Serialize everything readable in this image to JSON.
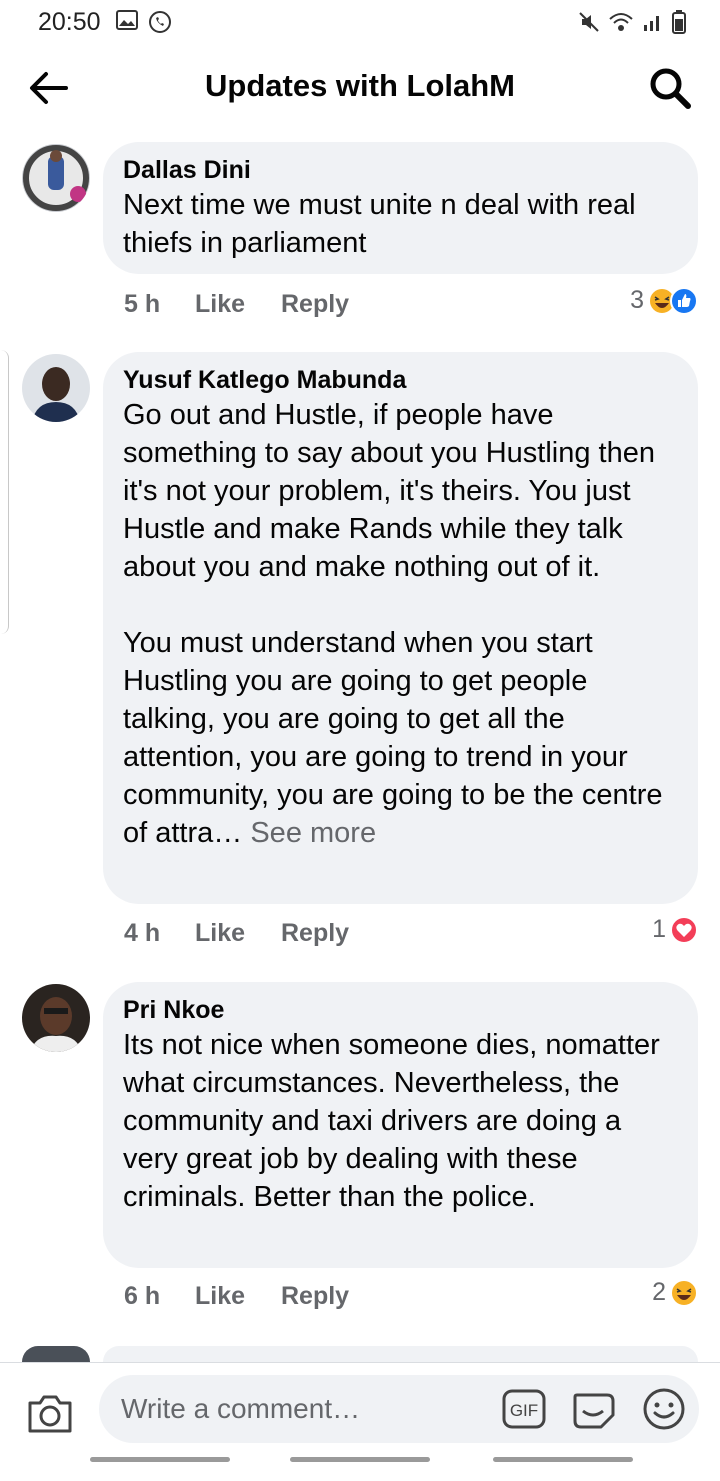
{
  "status_bar": {
    "time": "20:50",
    "icons_left": [
      "gallery-icon",
      "whatsapp-icon"
    ],
    "icons_right": [
      "mute-icon",
      "wifi-icon",
      "signal-icon",
      "battery-icon"
    ]
  },
  "header": {
    "title": "Updates with LolahM",
    "back_icon": "back-arrow-icon",
    "search_icon": "search-icon"
  },
  "comments": [
    {
      "author": "Dallas Dini",
      "text": "Next time we must  unite  n deal  with real  thiefs in parliament",
      "time": "5 h",
      "like_label": "Like",
      "reply_label": "Reply",
      "reaction_count": "3",
      "reactions": [
        "haha",
        "like"
      ]
    },
    {
      "author": "Yusuf Katlego Mabunda",
      "text": "Go out and Hustle, if people have something to say about you Hustling then it's not your problem, it's theirs. You just Hustle and make Rands while they talk about you and make nothing out of it.\n\nYou must understand when you start Hustling you are going to get people talking, you are going to get all the attention, you are going to trend in your community, you are going to be the centre of attra…",
      "see_more": "See more",
      "time": "4 h",
      "like_label": "Like",
      "reply_label": "Reply",
      "reaction_count": "1",
      "reactions": [
        "love"
      ]
    },
    {
      "author": "Pri Nkoe",
      "text": "Its not nice when someone dies, nomatter what circumstances. Nevertheless, the community and taxi drivers are doing a very great job by dealing with these criminals. Better than the police.",
      "time": "6 h",
      "like_label": "Like",
      "reply_label": "Reply",
      "reaction_count": "2",
      "reactions": [
        "haha"
      ]
    }
  ],
  "composer": {
    "placeholder": "Write a comment…",
    "gif_label": "GIF"
  },
  "colors": {
    "bubble_bg": "#f0f2f5",
    "secondary_text": "#65676b",
    "like_blue": "#1877f2",
    "love_red": "#f33e58",
    "haha_yellow": "#f7b125"
  }
}
